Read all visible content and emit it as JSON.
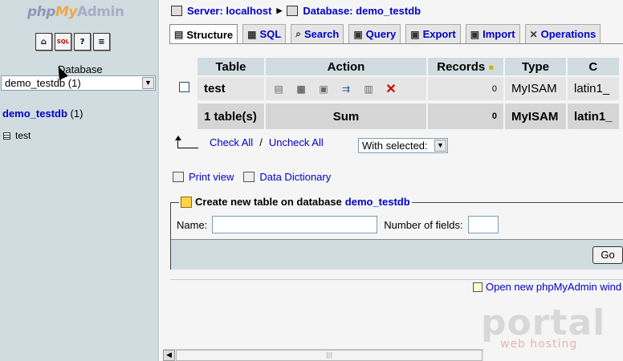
{
  "left": {
    "logo": {
      "php": "php",
      "my": "My",
      "admin": "Admin"
    },
    "icons": [
      "home-icon",
      "sql-icon",
      "help-icon",
      "docs-icon"
    ],
    "db_label": "Database",
    "db_select_value": "demo_testdb (1)",
    "db_link": "demo_testdb",
    "db_count": "(1)",
    "table_item": "test"
  },
  "main": {
    "breadcrumb": {
      "server": "Server: localhost",
      "database": "Database: demo_testdb"
    },
    "tabs": [
      {
        "label": "Structure",
        "icon": "structure-icon",
        "active": true
      },
      {
        "label": "SQL",
        "icon": "sql-icon"
      },
      {
        "label": "Search",
        "icon": "search-icon"
      },
      {
        "label": "Query",
        "icon": "query-icon"
      },
      {
        "label": "Export",
        "icon": "export-icon"
      },
      {
        "label": "Import",
        "icon": "import-icon"
      },
      {
        "label": "Operations",
        "icon": "operations-icon"
      }
    ],
    "table": {
      "headers": [
        "Table",
        "Action",
        "Records",
        "Type",
        "C"
      ],
      "rows": [
        {
          "name": "test",
          "records": "0",
          "type": "MyISAM",
          "collation": "latin1_"
        }
      ],
      "sum": {
        "label": "1 table(s)",
        "action": "Sum",
        "records": "0",
        "type": "MyISAM",
        "collation": "latin1_"
      }
    },
    "check_all": "Check All",
    "uncheck_all": "Uncheck All",
    "check_sep": "/",
    "with_selected": "With selected:",
    "print_view": "Print view",
    "data_dictionary": "Data Dictionary",
    "create": {
      "legend": "Create new table on database",
      "db": "demo_testdb",
      "name_label": "Name:",
      "fields_label": "Number of fields:",
      "go": "Go"
    },
    "open_new": "Open new phpMyAdmin wind"
  },
  "watermark": {
    "big": "portal",
    "small": "web hosting"
  }
}
